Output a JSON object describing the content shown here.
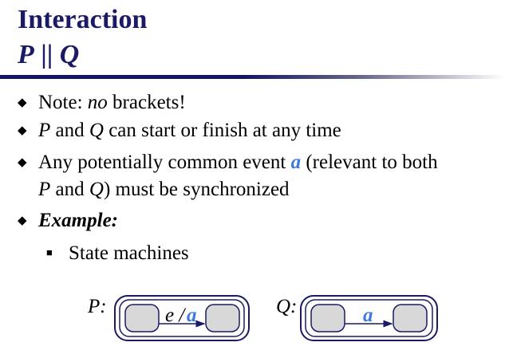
{
  "title": {
    "line1": "Interaction",
    "p": "P",
    "sep": " || ",
    "q": "Q"
  },
  "bullets": {
    "b1": {
      "pre": "Note: ",
      "em": "no",
      "post": " brackets!"
    },
    "b2": {
      "p": "P",
      "and": " and ",
      "q": "Q",
      "post": " can start or finish at any time"
    },
    "b3": {
      "pre": "Any potentially common event ",
      "a": "a",
      "post": " (relevant to both",
      "line2_p": "P",
      "line2_and": " and ",
      "line2_q": "Q",
      "line2_post": ") must be synchronized"
    },
    "b4": {
      "text": "Example:"
    },
    "sub1": {
      "text": "State machines"
    }
  },
  "diagram": {
    "p_label": "P:",
    "p_transition_event": "e /",
    "p_transition_action": "a",
    "q_label": "Q:",
    "q_transition_event": "a"
  },
  "colors": {
    "title": "#1a1a66",
    "accent": "#3b7be0",
    "state_fill": "#d8d8d8",
    "rule": "#141466"
  }
}
